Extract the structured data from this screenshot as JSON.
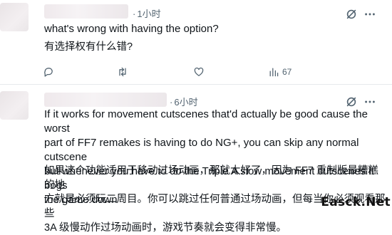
{
  "reply1": {
    "time": "1小时",
    "text_en": "what's wrong with having the option?",
    "text_zh": "有选择权有什么错?",
    "views_count": "67"
  },
  "reply2": {
    "time": "6小时",
    "text_en_lines": [
      "If it works for movement cutscenes that'd actually be good cause the worst",
      "part of FF7 remakes is having to do NG+, you can skip any normal cutscene",
      "but whenever you have to do the Triple A slow movement cutscenes it bogs",
      "the game down"
    ],
    "text_zh_lines": [
      "如果这个功能适用于移动过场动画，那就太好了，因为 FF7 重制版最糟糕的地",
      "方就是必须玩二周目。你可以跳过任何普通过场动画，但每当你必须观看那些",
      "3A 级慢动作过场动画时，游戏节奏就会变得非常慢。"
    ]
  },
  "watermark": "Easck.Net",
  "colors": {
    "text": "#0f1419",
    "secondary": "#536471",
    "divider": "#e6e9ec"
  }
}
